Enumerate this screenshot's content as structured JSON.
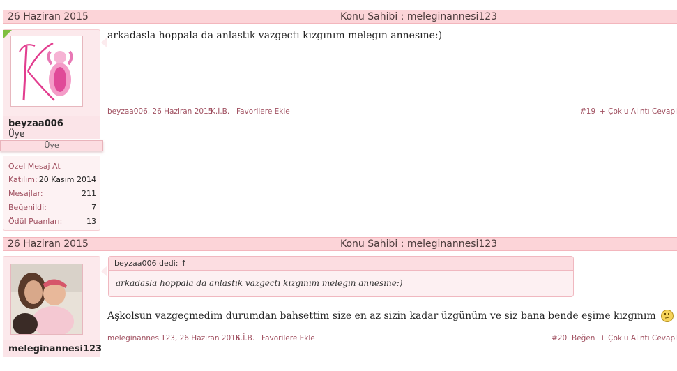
{
  "posts": [
    {
      "date": "26 Haziran 2015",
      "thread_owner": "Konu Sahibi : meleginannesi123",
      "user": {
        "name": "beyzaa006",
        "title": "Üye",
        "rank": "Üye",
        "pm_link": "Özel Mesaj At",
        "stats": [
          {
            "label": "Katılım:",
            "value": "20 Kasım 2014"
          },
          {
            "label": "Mesajlar:",
            "value": "211"
          },
          {
            "label": "Beğenildi:",
            "value": "7"
          },
          {
            "label": "Ödül Puanları:",
            "value": "13"
          }
        ]
      },
      "message": "arkadasla hoppala da anlastık vazgectı kızgınım melegın annesıne:)",
      "footer": {
        "author_date": "beyzaa006, 26 Haziran 2015",
        "kib": "K.İ.B.",
        "favorite": "Favorilere Ekle",
        "number": "#19",
        "multi_quote": "+ Çoklu Alıntı",
        "reply": "Cevapla"
      }
    },
    {
      "date": "26 Haziran 2015",
      "thread_owner": "Konu Sahibi : meleginannesi123",
      "user": {
        "name": "meleginannesi123"
      },
      "quote": {
        "author": "beyzaa006 dedi: ↑",
        "text": "arkadasla hoppala da anlastık vazgectı kızgınım melegın annesıne:)"
      },
      "message": "Aşkolsun vazgeçmedim durumdan bahsettim size en az sizin kadar üzgünüm ve siz bana bende eşime kızgınım",
      "footer": {
        "author_date": "meleginannesi123, 26 Haziran 2015",
        "kib": "K.İ.B.",
        "favorite": "Favorilere Ekle",
        "number": "#20",
        "like": "Beğen",
        "multi_quote": "+ Çoklu Alıntı",
        "reply": "Cevapla"
      }
    }
  ],
  "colors": {
    "header_bg": "#fcd4d8",
    "link": "#a05060",
    "panel_bg": "#fce9ec"
  }
}
